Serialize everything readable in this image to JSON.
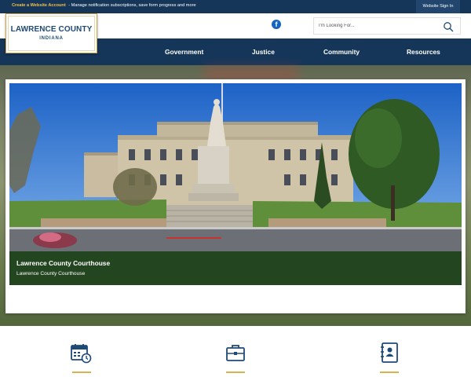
{
  "topbar": {
    "create_account_link": "Create a Website Account",
    "create_account_text": " - Manage notification subscriptions, save form progress and more",
    "sign_in": "Website Sign In"
  },
  "logo": {
    "line1": "LAWRENCE COUNTY",
    "line2": "INDIANA"
  },
  "social": {
    "facebook_glyph": "f"
  },
  "search": {
    "placeholder": "I'm Looking For..."
  },
  "nav": {
    "items": [
      {
        "label": "Government"
      },
      {
        "label": "Justice"
      },
      {
        "label": "Community"
      },
      {
        "label": "Resources"
      }
    ]
  },
  "slide": {
    "title": "Lawrence County Courthouse",
    "subtitle": "Lawrence County Courthouse"
  },
  "quick_links": [
    {
      "icon": "calendar-clock-icon"
    },
    {
      "icon": "briefcase-icon"
    },
    {
      "icon": "contact-book-icon"
    }
  ],
  "colors": {
    "primary_navy": "#163659",
    "accent_gold": "#d8b24e",
    "caption_green": "#23451f",
    "facebook_blue": "#1465c0"
  }
}
